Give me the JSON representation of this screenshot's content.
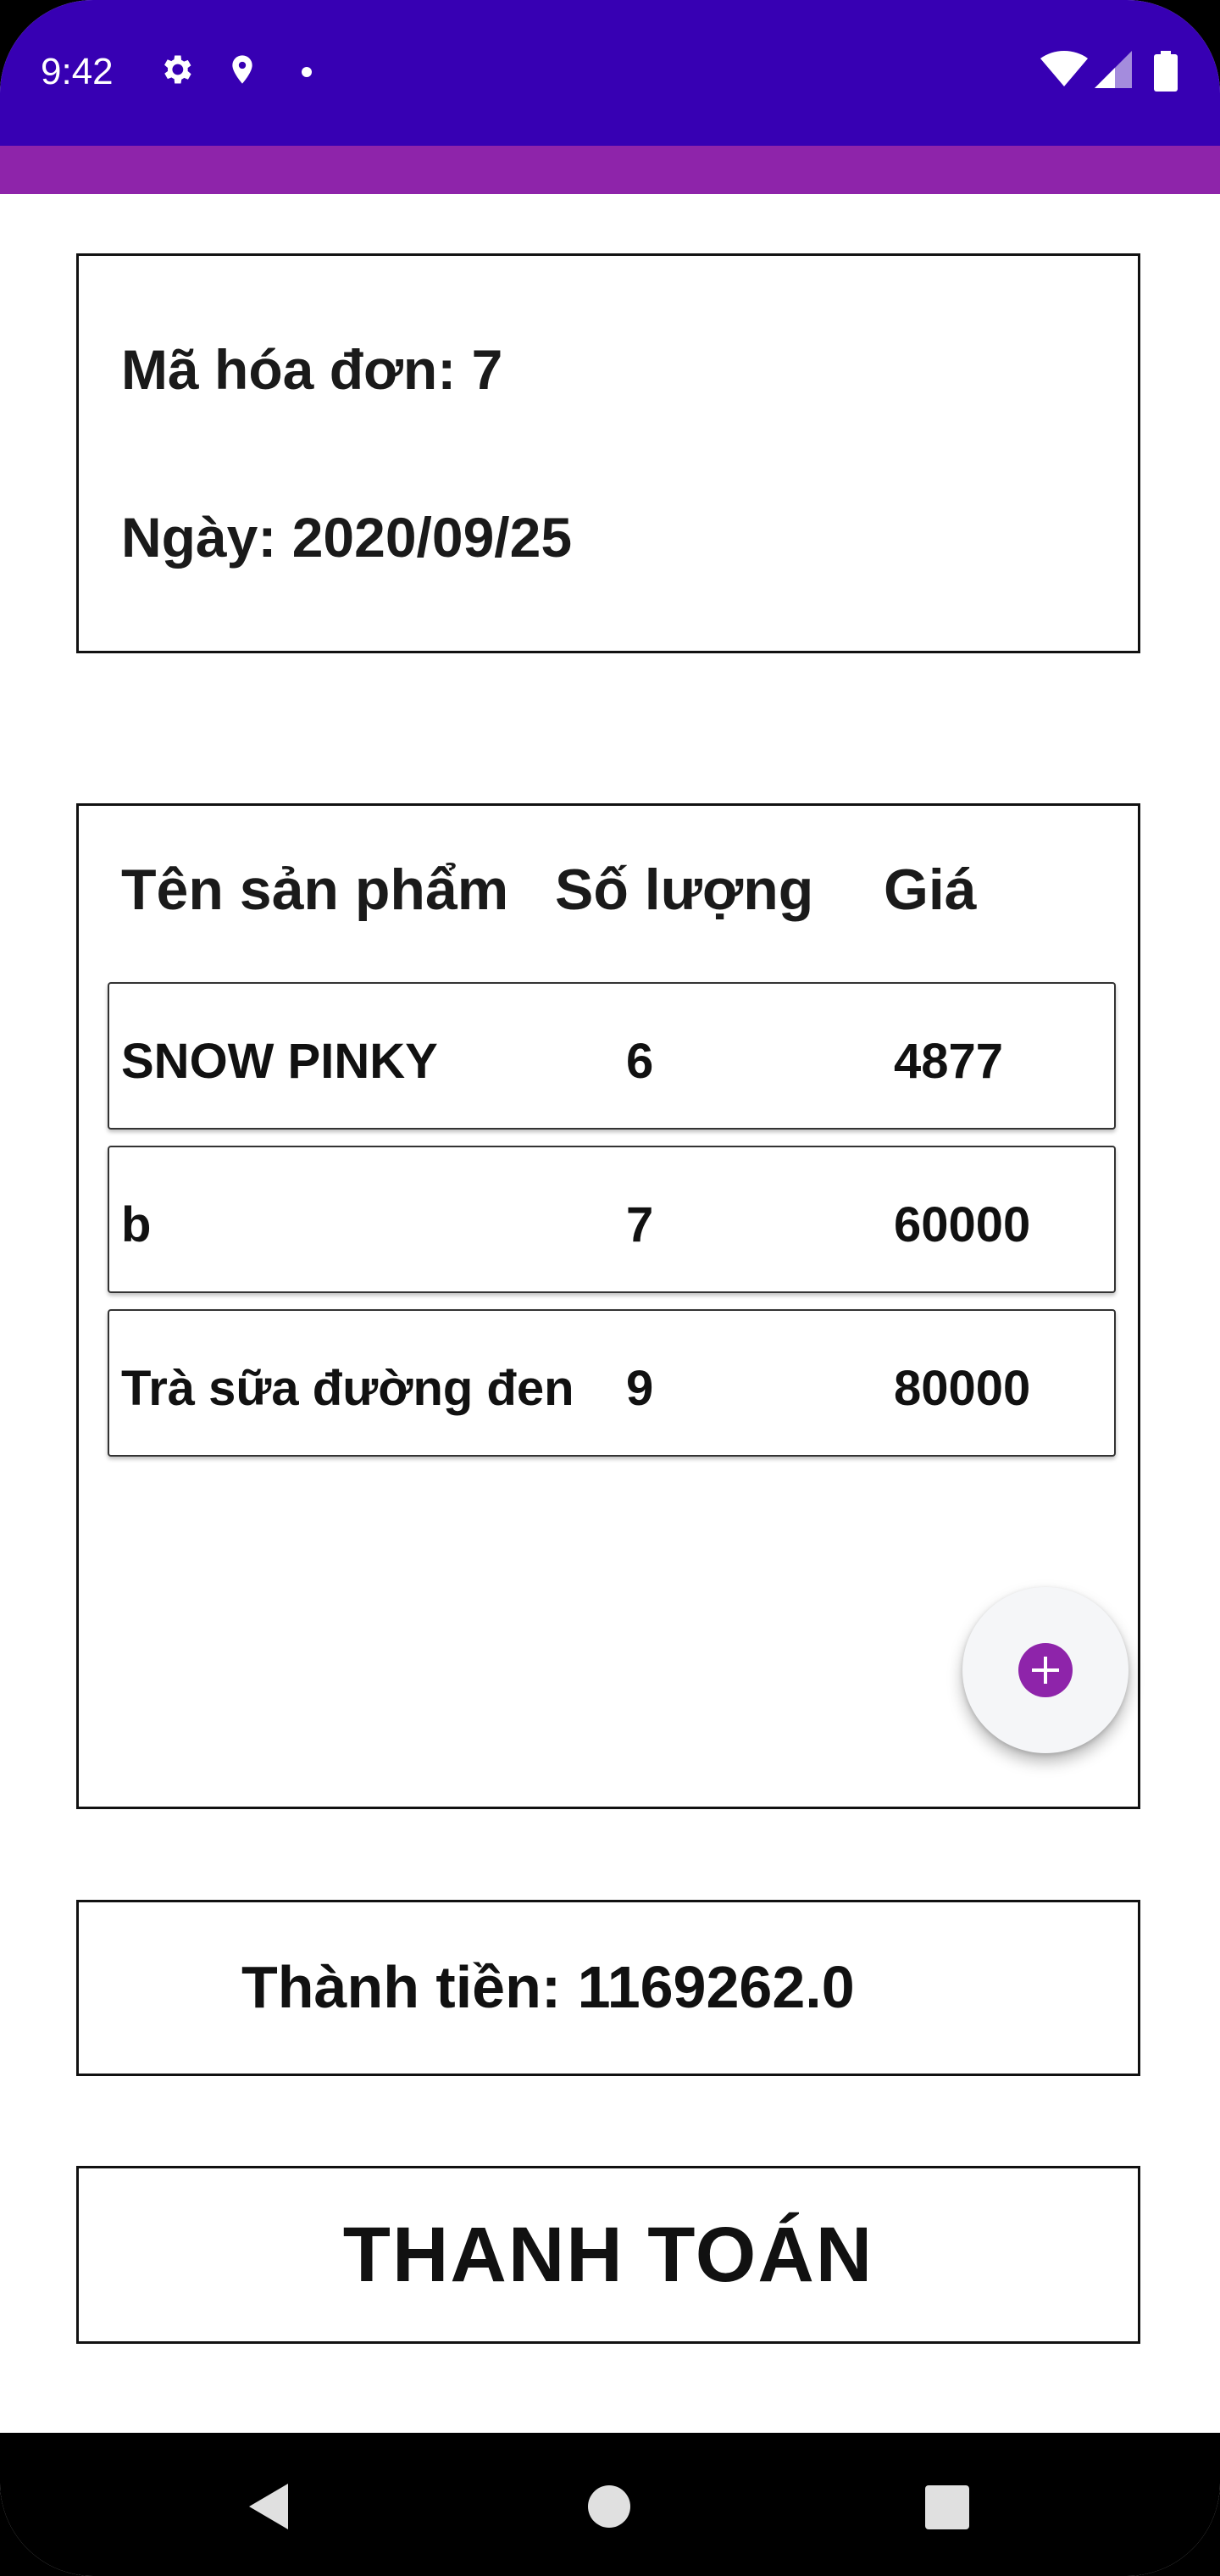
{
  "status_bar": {
    "time": "9:42",
    "icons": [
      "gear-icon",
      "location-icon",
      "dot-icon",
      "wifi-icon",
      "signal-icon",
      "battery-icon"
    ]
  },
  "colors": {
    "status_bar": "#3700b3",
    "app_bar": "#8e24aa",
    "accent": "#8e24aa"
  },
  "invoice": {
    "id_label": "Mã hóa đơn: 7",
    "date_label": "Ngày: 2020/09/25"
  },
  "table": {
    "headers": [
      "Tên sản phẩm",
      "Số lượng",
      "Giá"
    ],
    "rows": [
      {
        "name": "SNOW PINKY",
        "qty": "6",
        "price": "4877"
      },
      {
        "name": "b",
        "qty": "7",
        "price": "60000"
      },
      {
        "name": "Trà sữa đường đen",
        "qty": "9",
        "price": "80000"
      }
    ]
  },
  "fab": {
    "icon": "plus-icon"
  },
  "total": {
    "label": "Thành tiền: 1169262.0"
  },
  "pay": {
    "label": "THANH TOÁN"
  },
  "nav": {
    "icons": [
      "back-icon",
      "home-icon",
      "recents-icon"
    ]
  }
}
